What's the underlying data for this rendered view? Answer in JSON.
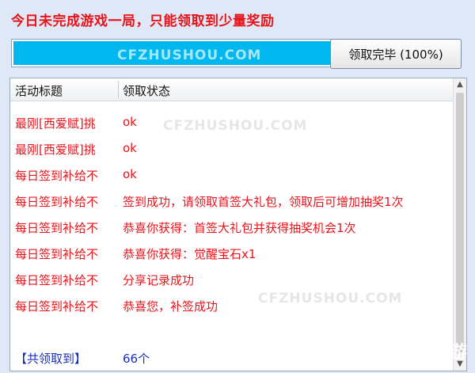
{
  "notice": "今日未完成游戏一局，只能领取到少量奖励",
  "progress": {
    "fraction": 1.0,
    "color": "#00b7ee"
  },
  "watermark": "CFZHUSHOU.COM",
  "claim_button": "领取完毕 (100%)",
  "list": {
    "headers": [
      "活动标题",
      "领取状态"
    ],
    "rows": [
      {
        "title": "最刚[西爱赋]挑",
        "status": "ok"
      },
      {
        "title": "最刚[西爱赋]挑",
        "status": "ok"
      },
      {
        "title": "每日签到补给不",
        "status": "ok"
      },
      {
        "title": "每日签到补给不",
        "status": "签到成功，请领取首签大礼包，领取后可增加抽奖1次"
      },
      {
        "title": "每日签到补给不",
        "status": "恭喜你获得：首签大礼包并获得抽奖机会1次"
      },
      {
        "title": "每日签到补给不",
        "status": "恭喜你获得：觉醒宝石x1"
      },
      {
        "title": "每日签到补给不",
        "status": "分享记录成功"
      },
      {
        "title": "每日签到补给不",
        "status": "恭喜您，补签成功"
      }
    ],
    "summary": {
      "label": "【共领取到】",
      "value": "66个"
    }
  },
  "logo": {
    "text": "九游",
    "icon": "swirl-logo-icon"
  },
  "colors": {
    "red_text": "#e8141b",
    "blue_text": "#1a2fb8",
    "background": "#dfe8f6"
  }
}
